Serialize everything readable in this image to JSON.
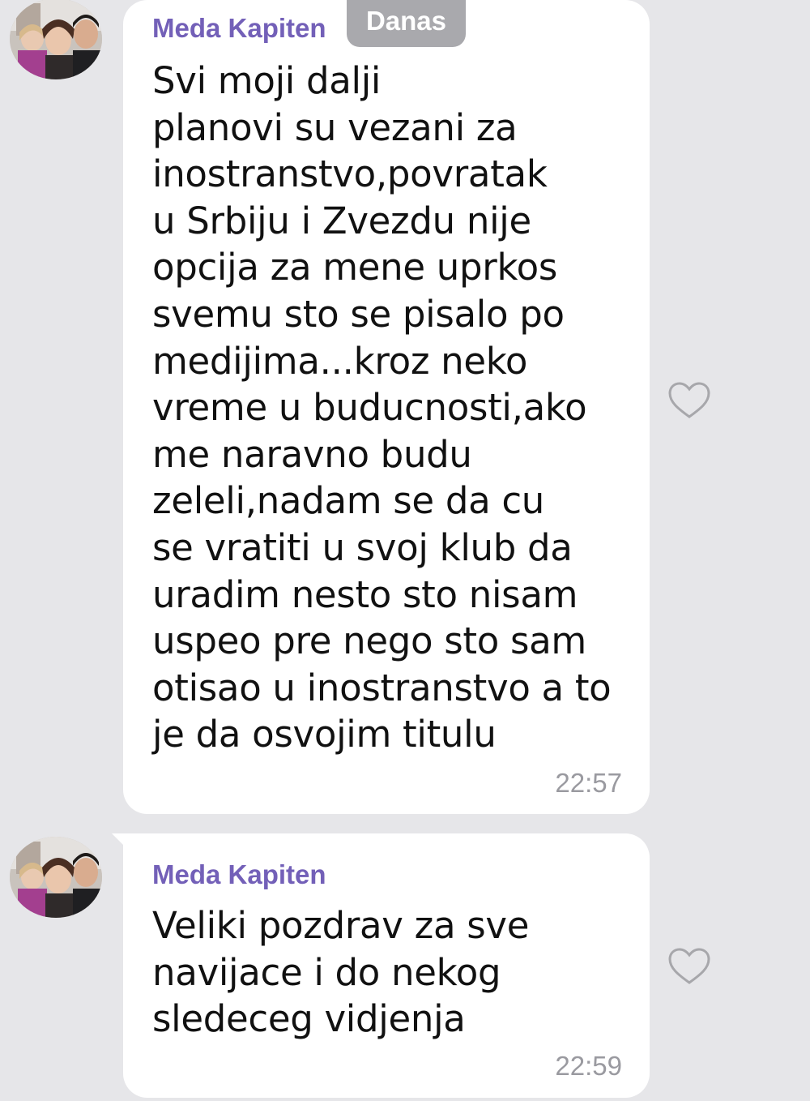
{
  "date_separator": "Danas",
  "messages": [
    {
      "sender": "Meda Kapiten",
      "text": "Svi moji dalji\nplanovi su vezani za\ninostranstvo,povratak\nu Srbiju i Zvezdu nije\nopcija za mene uprkos\nsvemu sto se pisalo po\nmedijima...kroz neko\nvreme u buducnosti,ako\nme naravno budu\nzeleli,nadam se da cu\nse vratiti u svoj klub da\nuradim nesto sto nisam\nuspeo pre nego sto sam\notisao u inostranstvo a to\nje da osvojim titulu",
      "time": "22:57",
      "icon": "heart-outline-icon"
    },
    {
      "sender": "Meda Kapiten",
      "text": "Veliki pozdrav za sve\nnavijace i do nekog\nsledeceg vidjenja",
      "time": "22:59",
      "icon": "heart-outline-icon"
    }
  ],
  "colors": {
    "background": "#e6e6e9",
    "bubble": "#ffffff",
    "sender_name": "#7360b8",
    "timestamp": "#9a9aa0",
    "date_badge": "#a9a9ad"
  }
}
